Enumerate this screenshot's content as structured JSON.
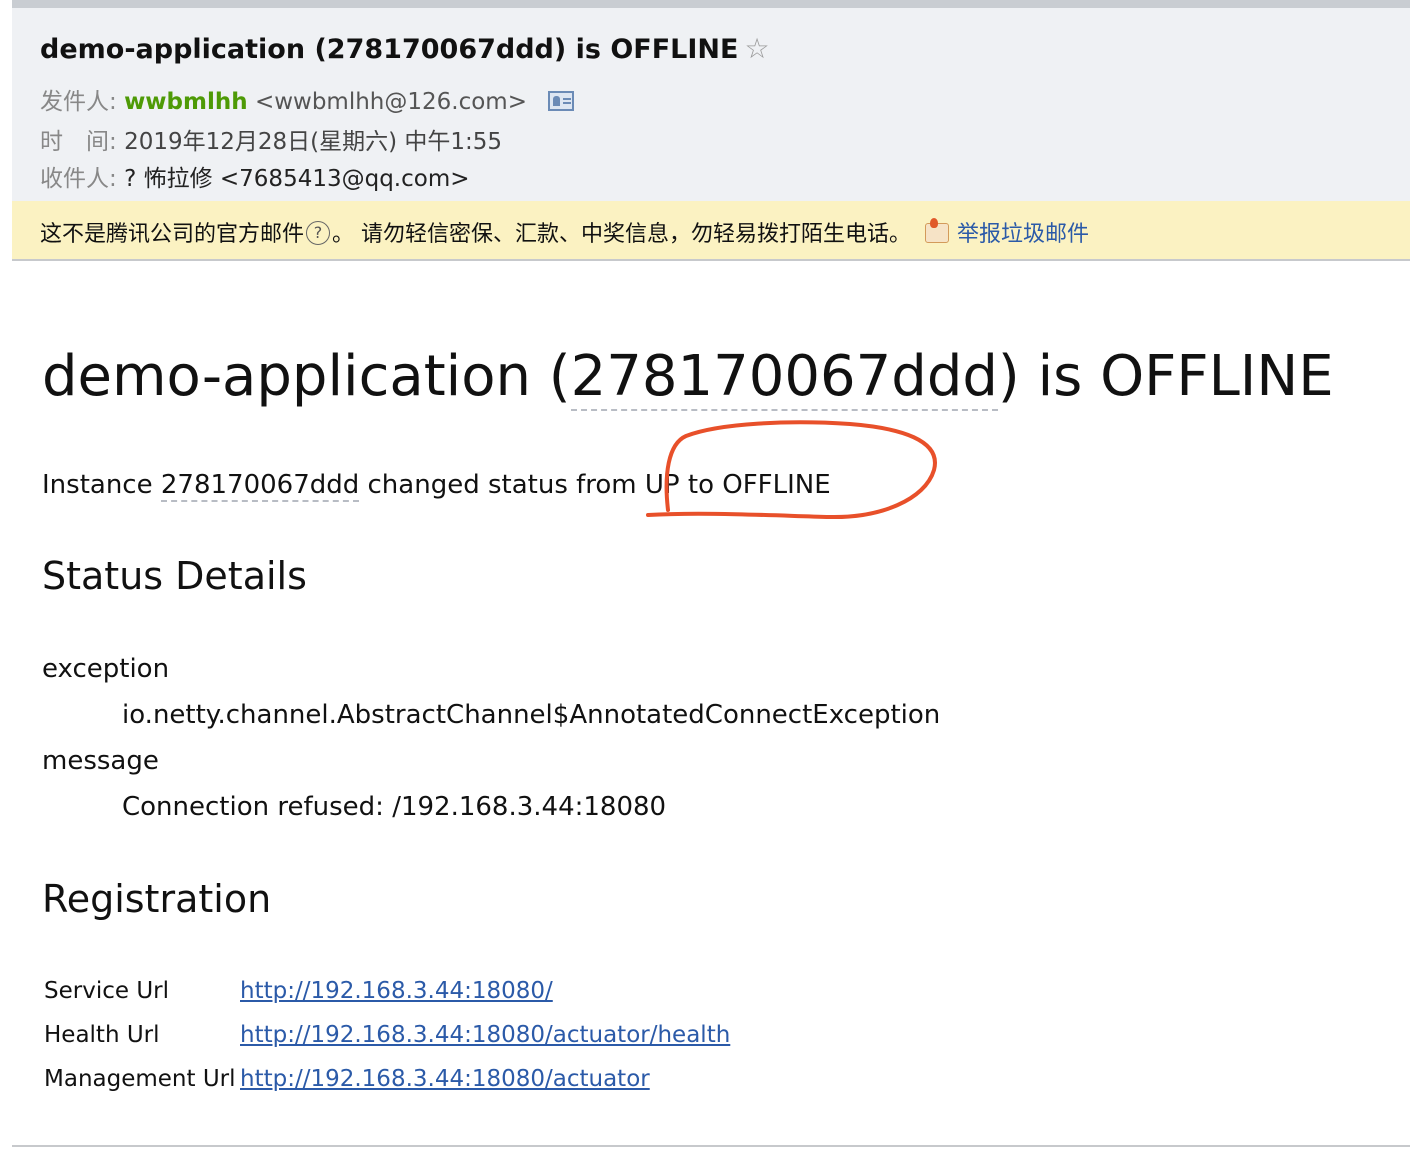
{
  "header": {
    "subject": "demo-application (278170067ddd) is OFFLINE",
    "sender_label": "发件人:",
    "sender_name": "wwbmlhh",
    "sender_email": "<wwbmlhh@126.com>",
    "time_label": "时　间:",
    "time_value": "2019年12月28日(星期六) 中午1:55",
    "recipient_label": "收件人:",
    "recipient_value": "? 怖拉修 <7685413@qq.com>"
  },
  "warning": {
    "text_before_icon": "这不是腾讯公司的官方邮件",
    "help_glyph": "?",
    "text_after_icon": "。  请勿轻信密保、汇款、中奖信息，勿轻易拨打陌生电话。",
    "report_link": "举报垃圾邮件"
  },
  "body": {
    "title_prefix": "demo-application (",
    "title_id": "278170067ddd",
    "title_suffix": ") is OFFLINE",
    "status_prefix": "Instance ",
    "status_id": "278170067ddd",
    "status_suffix": " changed status from UP to OFFLINE",
    "status_details_heading": "Status Details",
    "exception_label": "exception",
    "exception_value": "io.netty.channel.AbstractChannel$AnnotatedConnectException",
    "message_label": "message",
    "message_value": "Connection refused: /192.168.3.44:18080",
    "registration_heading": "Registration",
    "registration": [
      {
        "label": "Service Url",
        "url": "http://192.168.3.44:18080/"
      },
      {
        "label": "Health Url",
        "url": "http://192.168.3.44:18080/actuator/health"
      },
      {
        "label": "Management Url",
        "url": "http://192.168.3.44:18080/actuator"
      }
    ]
  },
  "colors": {
    "annotation": "#e8502a",
    "sender_name": "#4e9a06",
    "link": "#2b5aa8",
    "warning_bg": "#fbf2c2"
  }
}
